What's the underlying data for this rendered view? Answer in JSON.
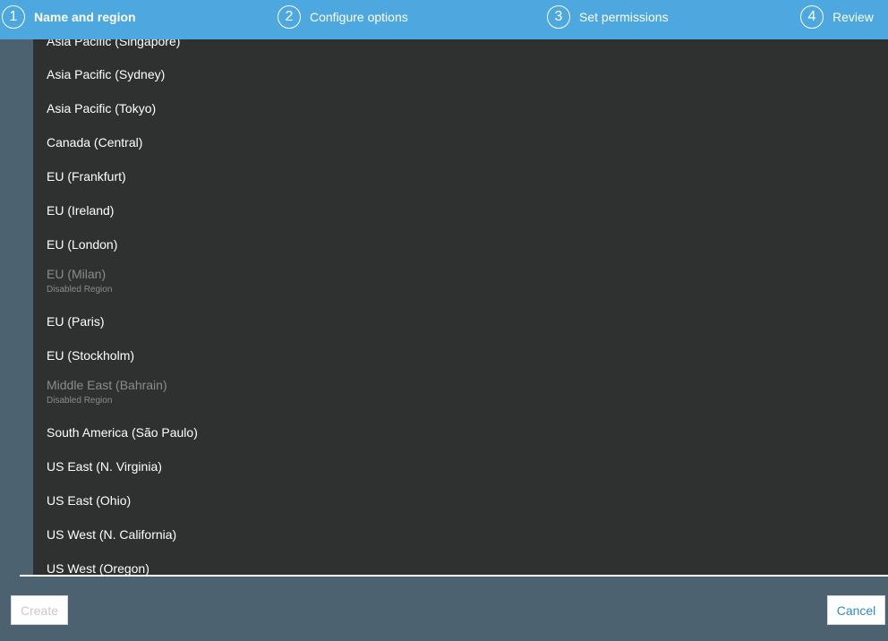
{
  "wizard": {
    "steps": [
      {
        "number": "1",
        "label": "Name and region"
      },
      {
        "number": "2",
        "label": "Configure options"
      },
      {
        "number": "3",
        "label": "Set permissions"
      },
      {
        "number": "4",
        "label": "Review"
      }
    ]
  },
  "region_dropdown": {
    "disabled_note": "Disabled Region",
    "options": [
      {
        "label": "Asia Pacific (Singapore)"
      },
      {
        "label": "Asia Pacific (Sydney)"
      },
      {
        "label": "Asia Pacific (Tokyo)"
      },
      {
        "label": "Canada (Central)"
      },
      {
        "label": "EU (Frankfurt)"
      },
      {
        "label": "EU (Ireland)"
      },
      {
        "label": "EU (London)"
      },
      {
        "label": "EU (Milan)"
      },
      {
        "label": "EU (Paris)"
      },
      {
        "label": "EU (Stockholm)"
      },
      {
        "label": "Middle East (Bahrain)"
      },
      {
        "label": "South America (São Paulo)"
      },
      {
        "label": "US East (N. Virginia)"
      },
      {
        "label": "US East (Ohio)"
      },
      {
        "label": "US West (N. California)"
      },
      {
        "label": "US West (Oregon)"
      }
    ]
  },
  "footer": {
    "create_label": "Create",
    "cancel_label": "Cancel"
  },
  "colors": {
    "header": "#4da8df",
    "background": "#4c6271",
    "dropdown": "#2f3030",
    "link": "#2e8bc9"
  }
}
